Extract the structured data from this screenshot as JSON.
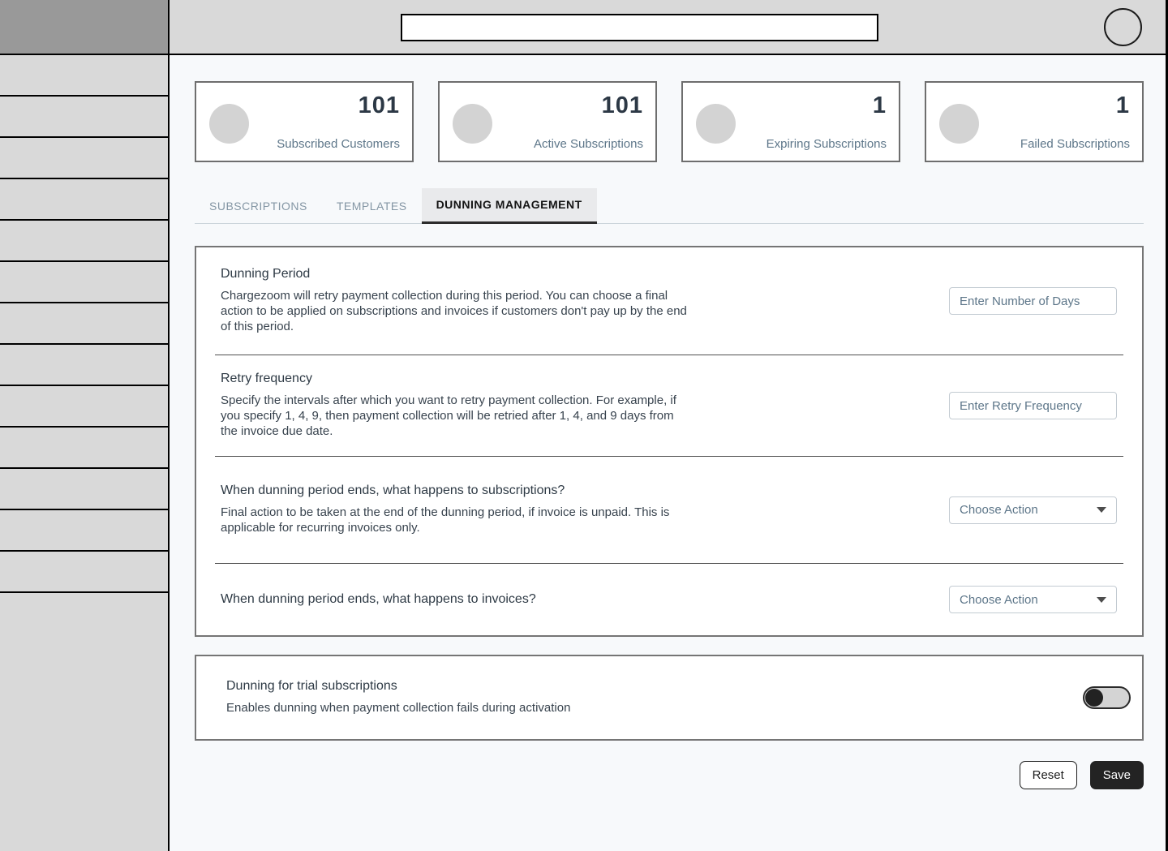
{
  "sidebar": {
    "item_count": 13
  },
  "topbar": {
    "search_placeholder": ""
  },
  "stats": [
    {
      "value": "101",
      "label": "Subscribed Customers"
    },
    {
      "value": "101",
      "label": "Active Subscriptions"
    },
    {
      "value": "1",
      "label": "Expiring Subscriptions"
    },
    {
      "value": "1",
      "label": "Failed Subscriptions"
    }
  ],
  "tabs": [
    {
      "label": "SUBSCRIPTIONS"
    },
    {
      "label": "TEMPLATES"
    },
    {
      "label": "DUNNING MANAGEMENT"
    }
  ],
  "dunning": {
    "period": {
      "title": "Dunning Period",
      "description": "Chargezoom will retry payment collection during this period. You can choose a final action to be applied on subscriptions and invoices if customers don't pay up by the end of this period.",
      "input_placeholder": "Enter Number of Days"
    },
    "retry": {
      "title": "Retry frequency",
      "description": "Specify the intervals after which you want to retry payment collection. For example, if you specify 1, 4, 9, then payment collection will be retried after 1, 4, and 9 days from the invoice due date.",
      "input_placeholder": "Enter Retry Frequency"
    },
    "subscriptions_action": {
      "title": "When dunning period ends, what happens to subscriptions?",
      "description": "Final action to be taken at the end of the dunning period, if invoice is unpaid. This is applicable for recurring invoices only.",
      "select_value": "Choose Action"
    },
    "invoices_action": {
      "title": "When dunning period ends, what happens to invoices?",
      "select_value": "Choose Action"
    },
    "trial": {
      "title": "Dunning for trial subscriptions",
      "description": "Enables dunning when payment collection fails during activation",
      "toggle_state": "off"
    }
  },
  "actions": {
    "reset_label": "Reset",
    "save_label": "Save"
  },
  "colors": {
    "accent_text": "#5d7689",
    "dark_text": "#2e3a45",
    "sidebar_gray": "#d9d9d9",
    "logo_gray": "#999999",
    "save_button": "#232323"
  }
}
